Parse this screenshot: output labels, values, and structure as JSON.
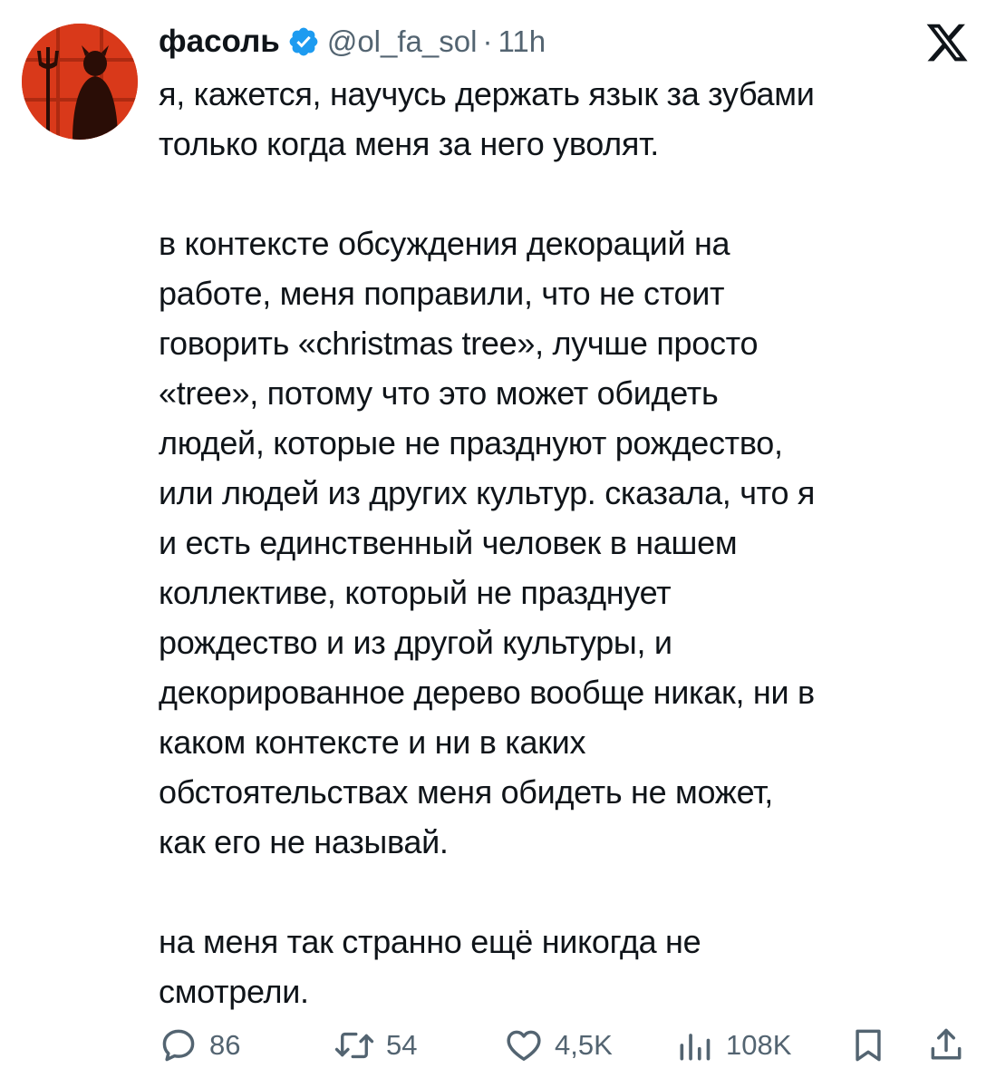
{
  "author": {
    "display_name": "фасоль",
    "handle": "@ol_fa_sol",
    "separator": "·",
    "timestamp": "11h"
  },
  "tweet": {
    "lines": [
      "я, кажется, научусь держать язык за зубами",
      "только когда меня за него уволят.",
      "",
      "в контексте обсуждения декораций на",
      "работе, меня поправили, что не стоит",
      "говорить «christmas tree», лучше просто",
      "«tree», потому что это может обидеть",
      "людей, которые не празднуют рождество,",
      "или людей из других культур. сказала, что я",
      "и есть единственный человек в нашем",
      "коллективе, который не празднует",
      "рождество и из другой культуры, и",
      "декорированное дерево вообще никак, ни в",
      "каком контексте и ни в каких",
      "обстоятельствах меня обидеть не может,",
      "как его не называй.",
      "",
      "на меня так странно ещё никогда не",
      "смотрели."
    ]
  },
  "actions": {
    "replies": "86",
    "retweets": "54",
    "likes": "4,5K",
    "views": "108K"
  },
  "icons": {
    "verified": "verified-badge-icon",
    "logo": "x-logo-icon",
    "reply": "reply-icon",
    "retweet": "retweet-icon",
    "like": "heart-icon",
    "views": "views-chart-icon",
    "bookmark": "bookmark-icon",
    "share": "share-icon"
  },
  "colors": {
    "text": "#0f1419",
    "secondary": "#536471",
    "verified": "#1d9bf0",
    "avatar_bg": "#d9391a"
  }
}
